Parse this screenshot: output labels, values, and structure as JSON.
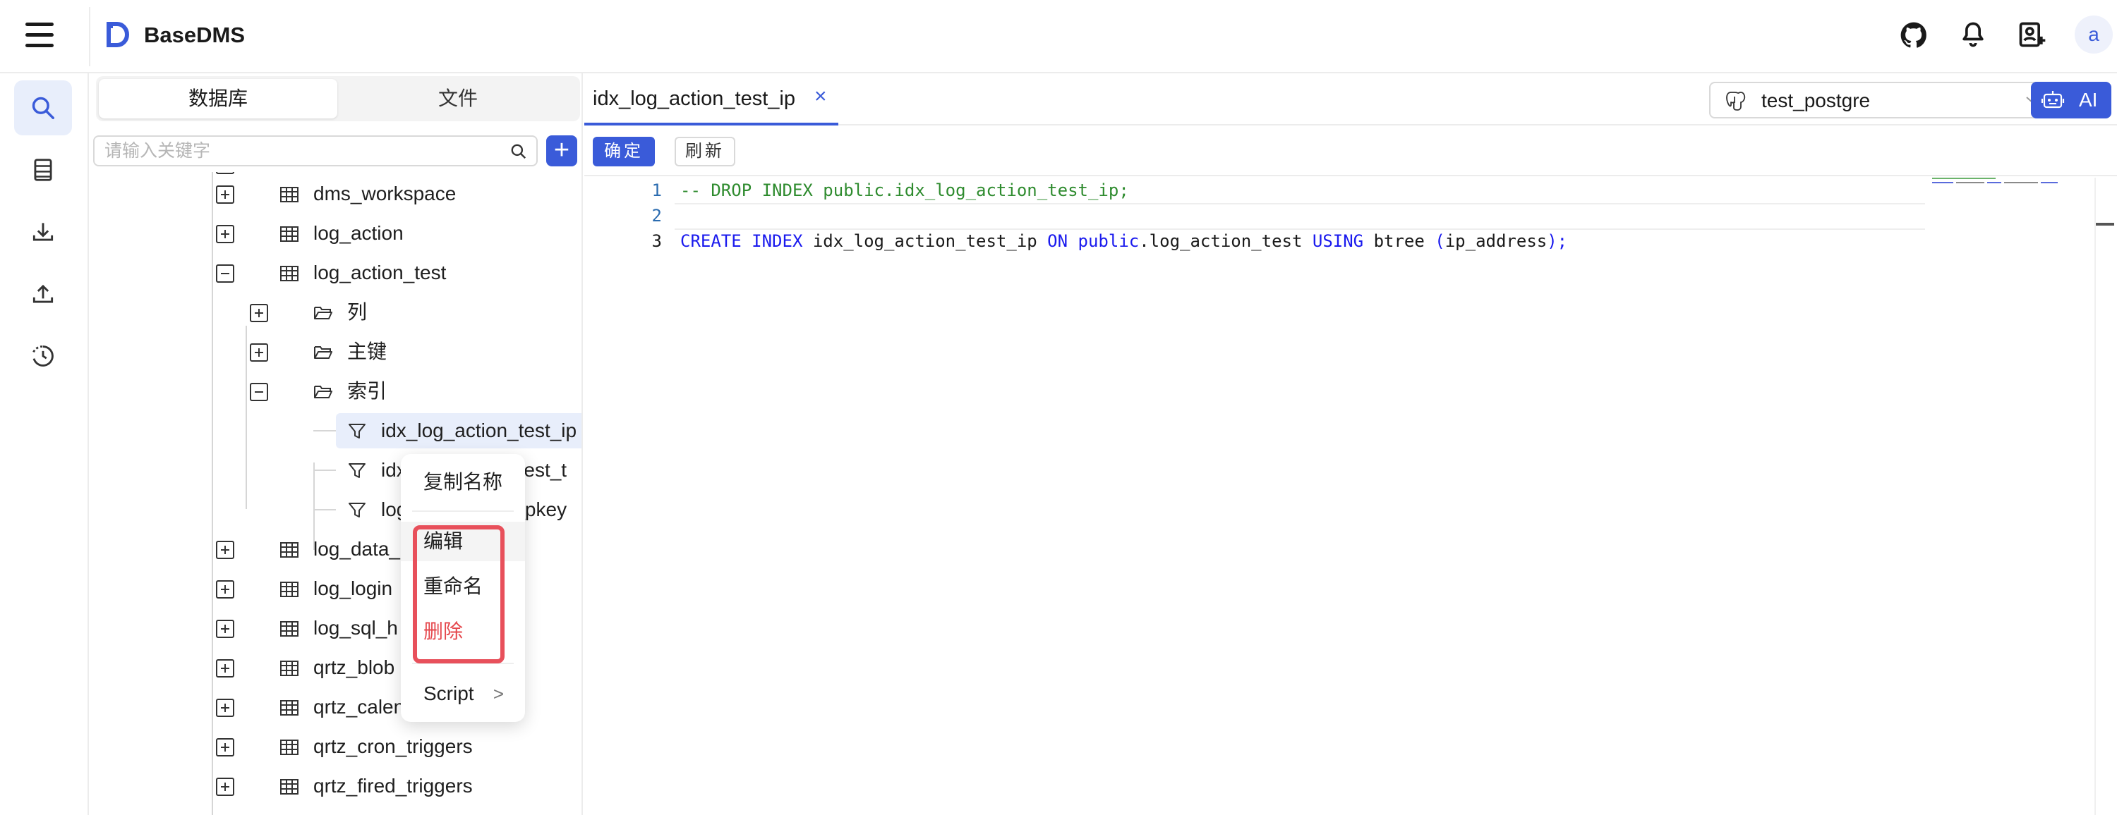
{
  "app": {
    "title": "BaseDMS",
    "avatar_letter": "a",
    "accent": "#3a5bd9"
  },
  "header": {
    "icons": [
      "github-icon",
      "bell-icon",
      "user-add-icon"
    ]
  },
  "leftnav": {
    "items": [
      "search-icon",
      "database-list-icon",
      "download-icon",
      "upload-icon",
      "history-icon"
    ],
    "active": 0
  },
  "sidebar": {
    "tabs": [
      "数据库",
      "文件"
    ],
    "active_tab": 0,
    "search_placeholder": "请输入关键字",
    "add_label": "+",
    "tree": [
      {
        "label": "dms_workspace",
        "type": "table",
        "expanded": false
      },
      {
        "label": "log_action",
        "type": "table",
        "expanded": false
      },
      {
        "label": "log_action_test",
        "type": "table",
        "expanded": true
      },
      {
        "label": "列",
        "type": "folder",
        "expanded": false
      },
      {
        "label": "主键",
        "type": "folder",
        "expanded": false
      },
      {
        "label": "索引",
        "type": "folder",
        "expanded": true
      },
      {
        "label": "idx_log_action_test_ip",
        "type": "index",
        "selected": true
      },
      {
        "label": "idx_log_action_test_t",
        "type": "index"
      },
      {
        "label": "log_action_test_pkey",
        "type": "index"
      },
      {
        "label": "log_data_",
        "type": "table",
        "expanded": false
      },
      {
        "label": "log_login",
        "type": "table",
        "expanded": false
      },
      {
        "label": "log_sql_h",
        "type": "table",
        "expanded": false
      },
      {
        "label": "qrtz_blob",
        "type": "table",
        "expanded": false
      },
      {
        "label": "qrtz_calendars",
        "type": "table",
        "expanded": false
      },
      {
        "label": "qrtz_cron_triggers",
        "type": "table",
        "expanded": false
      },
      {
        "label": "qrtz_fired_triggers",
        "type": "table",
        "expanded": false
      }
    ]
  },
  "context_menu": {
    "items": [
      {
        "label": "复制名称"
      },
      {
        "label": "编辑"
      },
      {
        "label": "重命名"
      },
      {
        "label": "删除",
        "danger": true
      },
      {
        "label": "Script",
        "submenu": ">"
      }
    ],
    "highlight_color": "#e8505b",
    "danger_color": "#e5484d"
  },
  "main": {
    "tab": {
      "label": "idx_log_action_test_ip",
      "close": "×"
    },
    "db_select": {
      "value": "test_postgre"
    },
    "ai_button": {
      "label": "AI"
    },
    "toolbar": {
      "confirm": "确定",
      "refresh": "刷新"
    },
    "editor": {
      "line_numbers": [
        "1",
        "2",
        "3"
      ],
      "line1": "-- DROP INDEX public.idx_log_action_test_ip;",
      "line3": {
        "kw1": "CREATE INDEX",
        "t1": " idx_log_action_test_ip ",
        "kw2": "ON",
        "sp1": " ",
        "kw3": "public",
        "t2": ".log_action_test ",
        "kw4": "USING",
        "t3": " btree ",
        "p1": "(",
        "t4": "ip_address",
        "p2": ");"
      }
    }
  }
}
